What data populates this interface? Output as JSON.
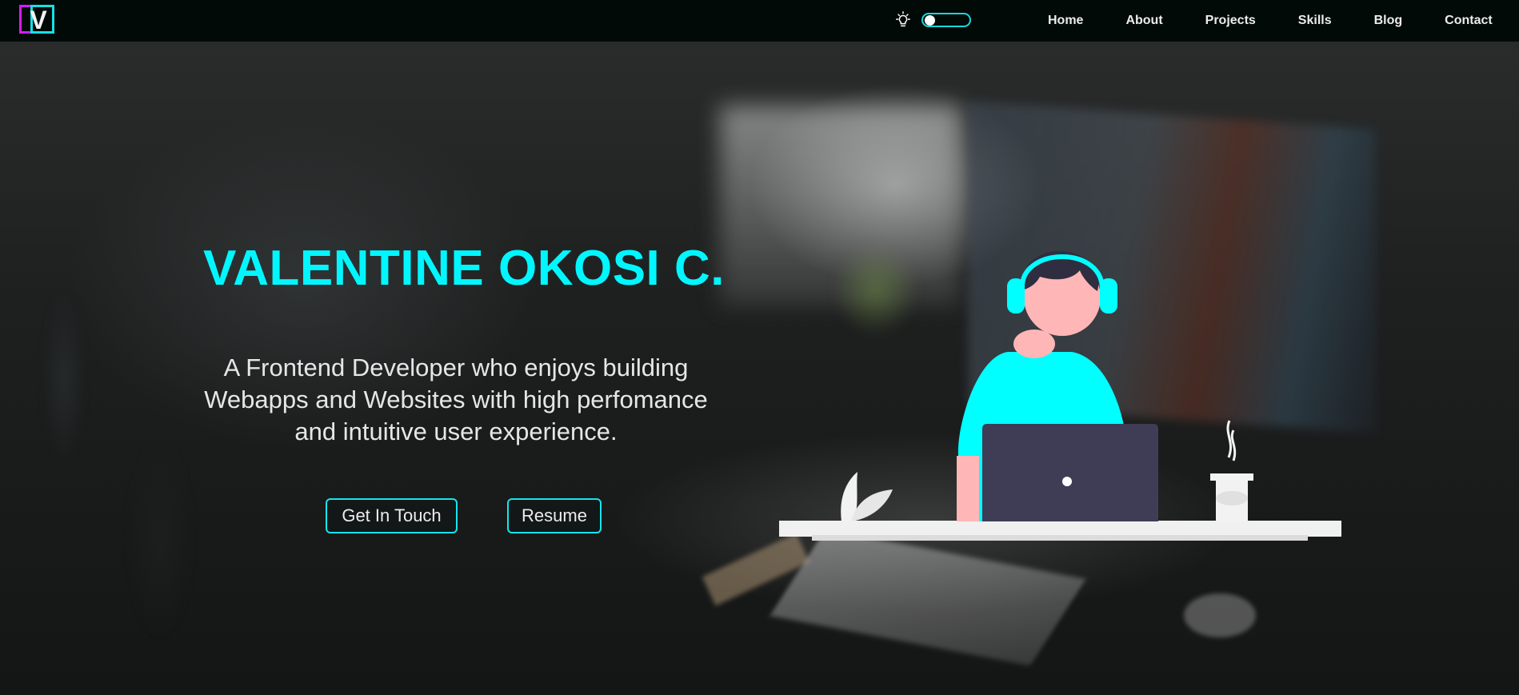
{
  "brand": {
    "logo_letter": "V",
    "logo_colors": [
      "#d21dff",
      "#16e0e6"
    ]
  },
  "nav": {
    "theme_icon": "lightbulb-icon",
    "links": [
      "Home",
      "About",
      "Projects",
      "Skills",
      "Blog",
      "Contact"
    ]
  },
  "hero": {
    "title": "VALENTINE OKOSI C.",
    "subtitle": "A Frontend Developer who enjoys building Webapps and Websites with high perfomance and intuitive user experience.",
    "buttons": {
      "contact": "Get In Touch",
      "resume": "Resume"
    }
  },
  "colors": {
    "accent": "#00f7ff",
    "navbar": "#020a07",
    "text": "#e6e6e6",
    "laptop": "#3f3d56",
    "skin": "#ffb6b6"
  }
}
